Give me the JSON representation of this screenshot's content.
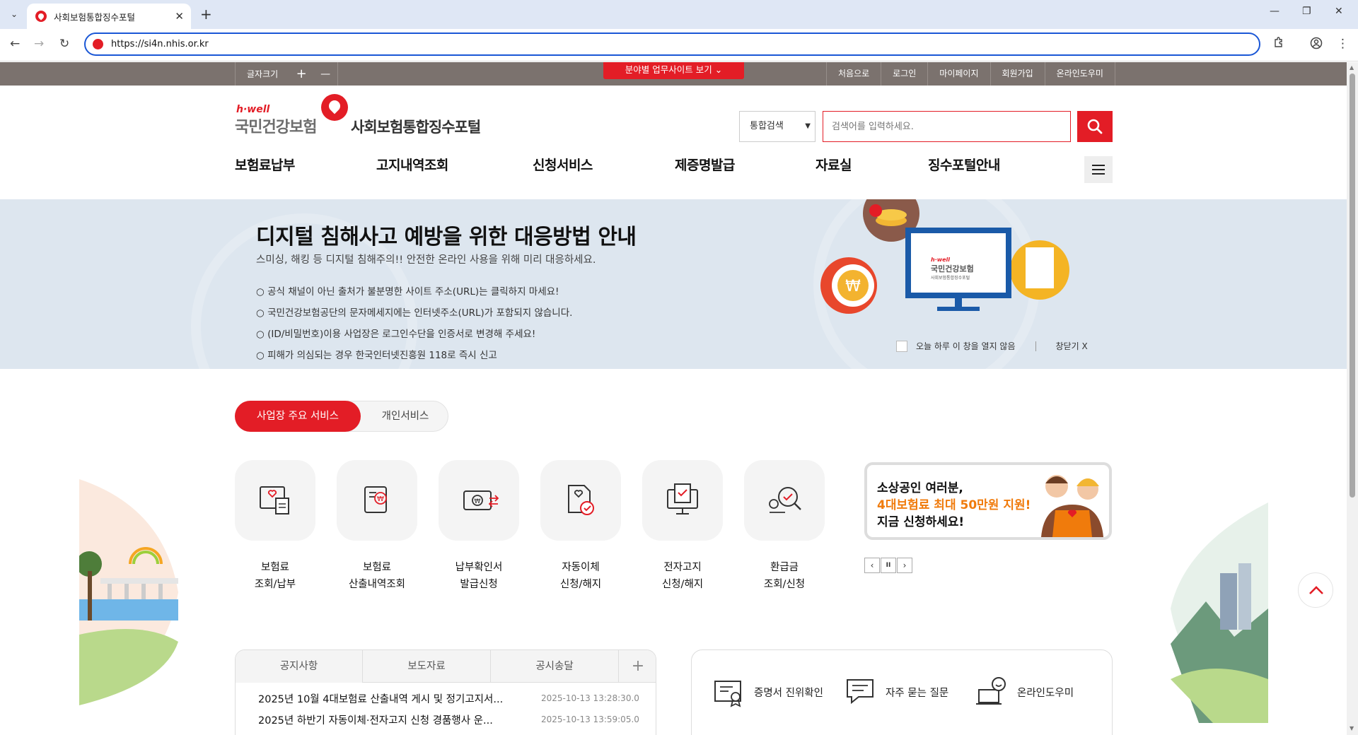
{
  "browser": {
    "tab_title": "사회보험통합징수포털",
    "url": "https://si4n.nhis.or.kr",
    "new_tab": "+",
    "tab_close": "✕",
    "tab_list": "⌄",
    "back": "←",
    "forward": "→",
    "reload": "↻",
    "win_min": "—",
    "win_max": "❐",
    "win_close": "✕",
    "menu": "⋮"
  },
  "util": {
    "font_size_label": "글자크기",
    "font_plus": "+",
    "font_minus": "—",
    "field_sites": "분야별 업무사이트 보기 ⌄",
    "links": [
      "처음으로",
      "로그인",
      "마이페이지",
      "회원가입",
      "온라인도우미"
    ]
  },
  "logo": {
    "brand_small": "h·well",
    "brand": "국민건강보험",
    "portal": "사회보험통합징수포털"
  },
  "search": {
    "scope": "통합검색",
    "placeholder": "검색어를 입력하세요."
  },
  "gnb": [
    "보험료납부",
    "고지내역조회",
    "신청서비스",
    "제증명발급",
    "자료실",
    "징수포털안내"
  ],
  "banner": {
    "title": "디지털 침해사고 예방을 위한 대응방법 안내",
    "subtitle": "스미싱, 해킹 등 디지털 침해주의!! 안전한 온라인 사용을 위해 미리 대응하세요.",
    "items": [
      "○ 공식 채널이 아닌 출처가 불분명한 사이트 주소(URL)는 클릭하지 마세요!",
      "○ 국민건강보험공단의 문자메세지에는 인터넷주소(URL)가 포함되지 않습니다.",
      "○ (ID/비밀번호)이용 사업장은 로그인수단을 인증서로 변경해 주세요!",
      "○ 피해가 의심되는 경우 한국인터넷진흥원 118로 즉시 신고"
    ],
    "dont_show_today": "오늘 하루 이 창을 열지 않음",
    "close_label": "창닫기 X",
    "screen_brand_small": "h·well",
    "screen_brand": "국민건강보험",
    "screen_portal": "사회보험통합징수포털"
  },
  "service_tabs": {
    "active": "사업장 주요 서비스",
    "inactive": "개인서비스"
  },
  "services": [
    {
      "line1": "보험료",
      "line2": "조회/납부",
      "icon": "document-heart-icon"
    },
    {
      "line1": "보험료",
      "line2": "산출내역조회",
      "icon": "scroll-won-icon"
    },
    {
      "line1": "납부확인서",
      "line2": "발급신청",
      "icon": "payment-card-icon"
    },
    {
      "line1": "자동이체",
      "line2": "신청/해지",
      "icon": "document-check-icon"
    },
    {
      "line1": "전자고지",
      "line2": "신청/해지",
      "icon": "monitor-check-icon"
    },
    {
      "line1": "환급금",
      "line2": "조회/신청",
      "icon": "magnifier-check-icon"
    }
  ],
  "promo": {
    "line1": "소상공인 여러분,",
    "line2": "4대보험료 최대 50만원 지원!",
    "line3": "지금 신청하세요!"
  },
  "slider": {
    "prev": "‹",
    "pause": "II",
    "next": "›"
  },
  "board": {
    "tabs": [
      "공지사항",
      "보도자료",
      "공시송달"
    ],
    "more": "+",
    "rows": [
      {
        "title": "2025년 10월 4대보험료 산출내역 게시 및 정기고지서...",
        "date": "2025-10-13 13:28:30.0"
      },
      {
        "title": "2025년 하반기 자동이체·전자고지 신청 경품행사 운...",
        "date": "2025-10-13 13:59:05.0"
      }
    ]
  },
  "quick_links": [
    {
      "label": "증명서 진위확인",
      "icon": "certificate-icon"
    },
    {
      "label": "자주 묻는 질문",
      "icon": "chat-bubble-icon"
    },
    {
      "label": "온라인도우미",
      "icon": "helper-laptop-icon"
    }
  ],
  "colors": {
    "brand_red": "#e31d26",
    "util_bar": "#7b726e",
    "banner_bg": "#dde6ef",
    "promo_orange": "#f07b0c"
  }
}
